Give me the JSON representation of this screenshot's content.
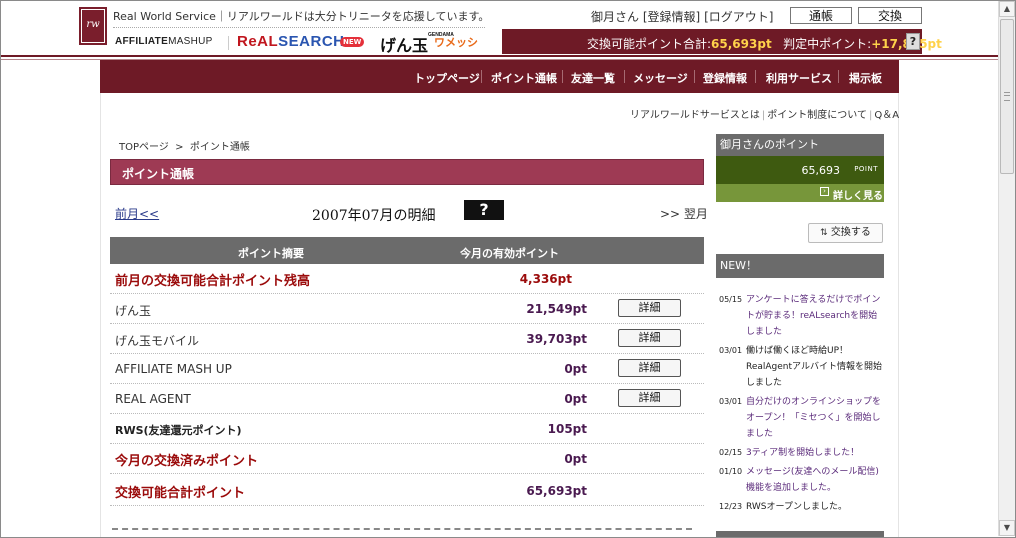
{
  "header": {
    "logo_text": "rw",
    "tagline": "Real World Service｜リアルワールドは大分トリニータを応援しています。",
    "brands": {
      "affiliate": "AFFILIATE",
      "affiliate_mashup": "MASHUP",
      "realsearch_a": "ReAL",
      "realsearch_b": "SEARCH",
      "new_badge": "NEW",
      "gendama_sub": "GENDAMA",
      "gendama": "げん玉",
      "mezon": "ワメッシ"
    },
    "user_name": "御月さん",
    "bracket_open_1": "[",
    "link_registration": "登録情報",
    "bracket_close_1": "]",
    "bracket_open_2": "[",
    "link_logout": "ログアウト",
    "bracket_close_2": "]",
    "btn_passbook": "通帳",
    "btn_exchange": "交換",
    "exchangeable_label": "交換可能ポイント合計:",
    "exchangeable_value": "65,693pt",
    "pending_label": "判定中ポイント:",
    "pending_value": "+17,825pt",
    "help_q": "?"
  },
  "nav": {
    "items": [
      "トップページ",
      "ポイント通帳",
      "友達一覧",
      "メッセージ",
      "登録情報",
      "利用サービス",
      "掲示板"
    ]
  },
  "subnav": {
    "about": "リアルワールドサービスとは",
    "points": "ポイント制度について",
    "qa": "Q＆A",
    "pipe": "|"
  },
  "breadcrumb": {
    "top": "TOPページ",
    "sep": ">",
    "current": "ポイント通帳"
  },
  "page_title": "ポイント通帳",
  "month_nav": {
    "prev": "前月<<",
    "title": "2007年07月の明細",
    "help": "?",
    "next": ">> 翌月"
  },
  "table": {
    "col_summary": "ポイント摘要",
    "col_points": "今月の有効ポイント",
    "detail_label": "詳細",
    "rows": [
      {
        "label": "前月の交換可能合計ポイント残高",
        "value": "4,336pt"
      },
      {
        "label": "げん玉",
        "value": "21,549pt"
      },
      {
        "label": "げん玉モバイル",
        "value": "39,703pt"
      },
      {
        "label": "AFFILIATE MASH UP",
        "value": "0pt"
      },
      {
        "label": "REAL AGENT",
        "value": "0pt"
      },
      {
        "label": "RWS(友達還元ポイント)",
        "value": "105pt"
      },
      {
        "label": "今月の交換済みポイント",
        "value": "0pt"
      },
      {
        "label": "交換可能合計ポイント",
        "value": "65,693pt"
      }
    ]
  },
  "sidebar": {
    "points_header": "御月さんのポイント",
    "points_value": "65,693",
    "points_unit": "POINT",
    "more_label": "詳しく見る",
    "exchange_label": "交換する",
    "news_header": "NEW！",
    "news": [
      {
        "date": "05/15",
        "text": "アンケートに答えるだけでポイントが貯まる！reALsearchを開始しました"
      },
      {
        "date": "03/01",
        "text": "働けば働くほど時給UP！RealAgentアルバイト情報を開始しました"
      },
      {
        "date": "03/01",
        "text": "自分だけのオンラインショップをオープン！「ミセつく」を開始しました"
      },
      {
        "date": "02/15",
        "text": "3ティア制を開始しました！"
      },
      {
        "date": "01/10",
        "text": "メッセージ(友達へのメール配信)機能を追加しました。"
      },
      {
        "date": "12/23",
        "text": "RWSオープンしました。"
      }
    ]
  }
}
